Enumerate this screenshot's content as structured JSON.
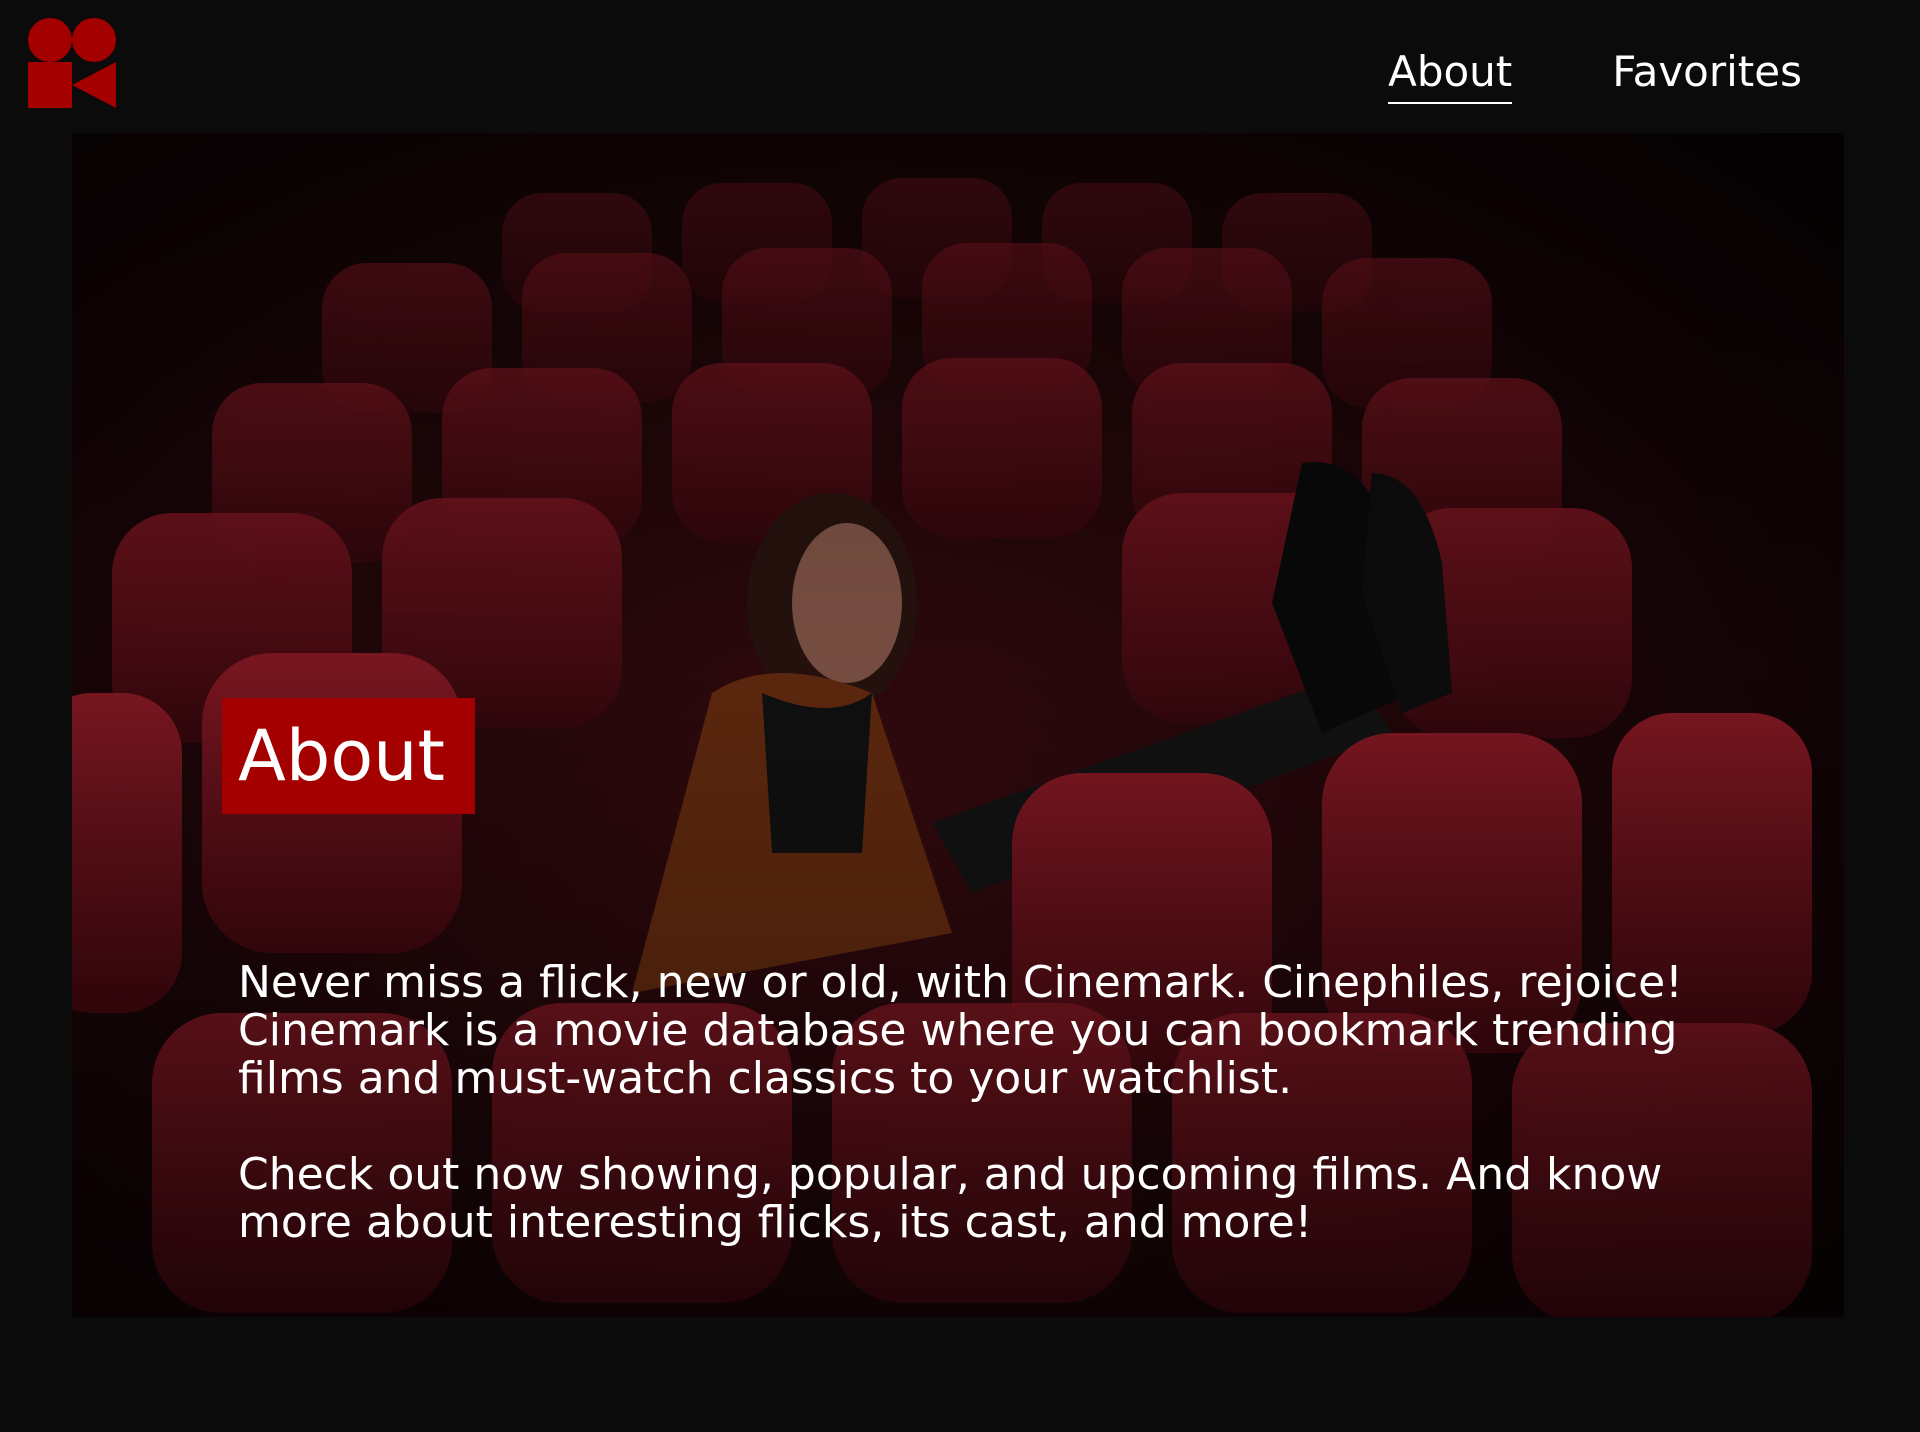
{
  "brand": {
    "logo_icon": "film-camera-logo-icon",
    "accent_color": "#a50000"
  },
  "nav": {
    "items": [
      {
        "label": "About",
        "active": true
      },
      {
        "label": "Favorites",
        "active": false
      }
    ]
  },
  "hero": {
    "image": "woman-in-empty-cinema-seats-photo",
    "badge": "About",
    "paragraph_1": "Never miss a flick, new or old, with Cinemark. Cinephiles, rejoice! Cinemark is a movie database where you can bookmark trending films and must-watch classics to your watchlist.",
    "paragraph_2": "Check out now showing, popular, and upcoming films. And know more about interesting flicks, its cast, and more!"
  }
}
